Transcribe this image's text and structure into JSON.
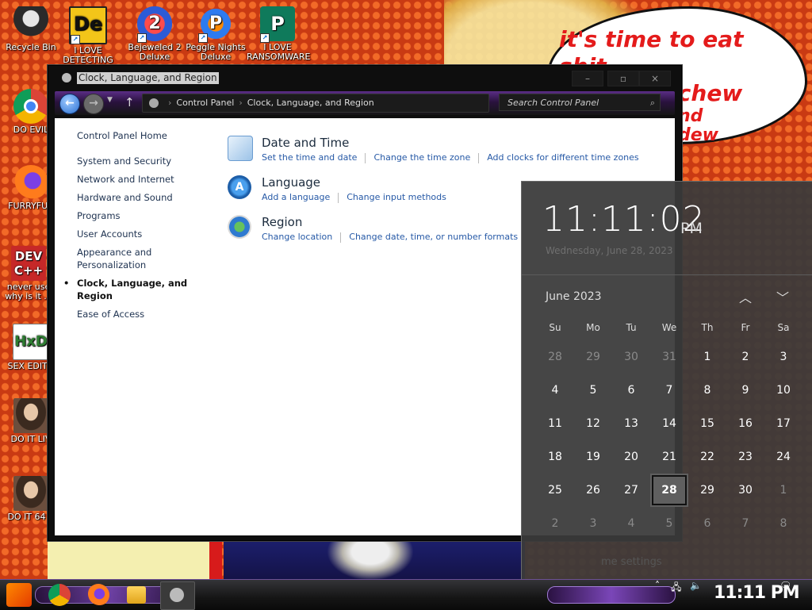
{
  "wallpaper": {
    "bubble_lines": [
      "it's time to eat shit",
      "d chew",
      "nd",
      "dew"
    ]
  },
  "desktop_icons": [
    {
      "label": "Recycle Bin",
      "icon": "recycle-bin-icon"
    },
    {
      "label": "I LOVE DETECTING",
      "icon": "de-app-icon"
    },
    {
      "label": "Bejeweled 2 Deluxe",
      "icon": "bejeweled-icon"
    },
    {
      "label": "Peggle Nights Deluxe",
      "icon": "peggle-icon"
    },
    {
      "label": "I LOVE RANSOMWARE",
      "icon": "publisher-icon"
    },
    {
      "label": "DO EVIL",
      "icon": "chrome-icon"
    },
    {
      "label": "FURRYFUC",
      "icon": "firefox-icon"
    },
    {
      "label": "never use why is it ...",
      "icon": "devcpp-icon"
    },
    {
      "label": "SEX EDITO",
      "icon": "hxd-icon"
    },
    {
      "label": "DO IT LIV",
      "icon": "portrait-icon"
    },
    {
      "label": "DO IT 64 B",
      "icon": "portrait-icon"
    }
  ],
  "window": {
    "title": "Clock, Language, and Region",
    "buttons": {
      "minimize": "–",
      "maximize": "▫",
      "close": "×"
    },
    "address": {
      "root": "Control Panel",
      "current": "Clock, Language, and Region"
    },
    "search_placeholder": "Search Control Panel",
    "sidebar": {
      "home": "Control Panel Home",
      "items": [
        "System and Security",
        "Network and Internet",
        "Hardware and Sound",
        "Programs",
        "User Accounts",
        "Appearance and Personalization",
        "Clock, Language, and Region",
        "Ease of Access"
      ],
      "current": "Clock, Language, and Region"
    },
    "categories": [
      {
        "title": "Date and Time",
        "icon": "date-time-icon",
        "links": [
          "Set the time and date",
          "Change the time zone",
          "Add clocks for different time zones"
        ]
      },
      {
        "title": "Language",
        "icon": "language-icon",
        "links": [
          "Add a language",
          "Change input methods"
        ]
      },
      {
        "title": "Region",
        "icon": "region-icon",
        "links": [
          "Change location",
          "Change date, time, or number formats"
        ]
      }
    ]
  },
  "clock_flyout": {
    "time": "11:11:02",
    "ampm": "PM",
    "date": "Wednesday, June 28, 2023",
    "month": "June 2023",
    "weekdays": [
      "Su",
      "Mo",
      "Tu",
      "We",
      "Th",
      "Fr",
      "Sa"
    ],
    "weeks": [
      [
        {
          "d": "28",
          "dim": true
        },
        {
          "d": "29",
          "dim": true
        },
        {
          "d": "30",
          "dim": true
        },
        {
          "d": "31",
          "dim": true
        },
        {
          "d": "1"
        },
        {
          "d": "2"
        },
        {
          "d": "3"
        }
      ],
      [
        {
          "d": "4"
        },
        {
          "d": "5"
        },
        {
          "d": "6"
        },
        {
          "d": "7"
        },
        {
          "d": "8"
        },
        {
          "d": "9"
        },
        {
          "d": "10"
        }
      ],
      [
        {
          "d": "11"
        },
        {
          "d": "12"
        },
        {
          "d": "13"
        },
        {
          "d": "14"
        },
        {
          "d": "15"
        },
        {
          "d": "16"
        },
        {
          "d": "17"
        }
      ],
      [
        {
          "d": "18"
        },
        {
          "d": "19"
        },
        {
          "d": "20"
        },
        {
          "d": "21"
        },
        {
          "d": "22"
        },
        {
          "d": "23"
        },
        {
          "d": "24"
        }
      ],
      [
        {
          "d": "25"
        },
        {
          "d": "26"
        },
        {
          "d": "27"
        },
        {
          "d": "28",
          "today": true
        },
        {
          "d": "29"
        },
        {
          "d": "30"
        },
        {
          "d": "1",
          "dim": true
        }
      ],
      [
        {
          "d": "2",
          "dim": true
        },
        {
          "d": "3",
          "dim": true
        },
        {
          "d": "4",
          "dim": true
        },
        {
          "d": "5",
          "dim": true
        },
        {
          "d": "6",
          "dim": true
        },
        {
          "d": "7",
          "dim": true
        },
        {
          "d": "8",
          "dim": true
        }
      ]
    ],
    "settings_link": "me settings"
  },
  "taskbar": {
    "clock": "11:11 PM",
    "tray_icons": [
      "chevron-up-icon",
      "network-icon",
      "volume-icon",
      "notification-icon"
    ]
  },
  "colors": {
    "link": "#2659a6",
    "nav_purple": "#5a2d86",
    "flyout_bg": "#3a3a3a",
    "bubble_text": "#e41b1b"
  }
}
